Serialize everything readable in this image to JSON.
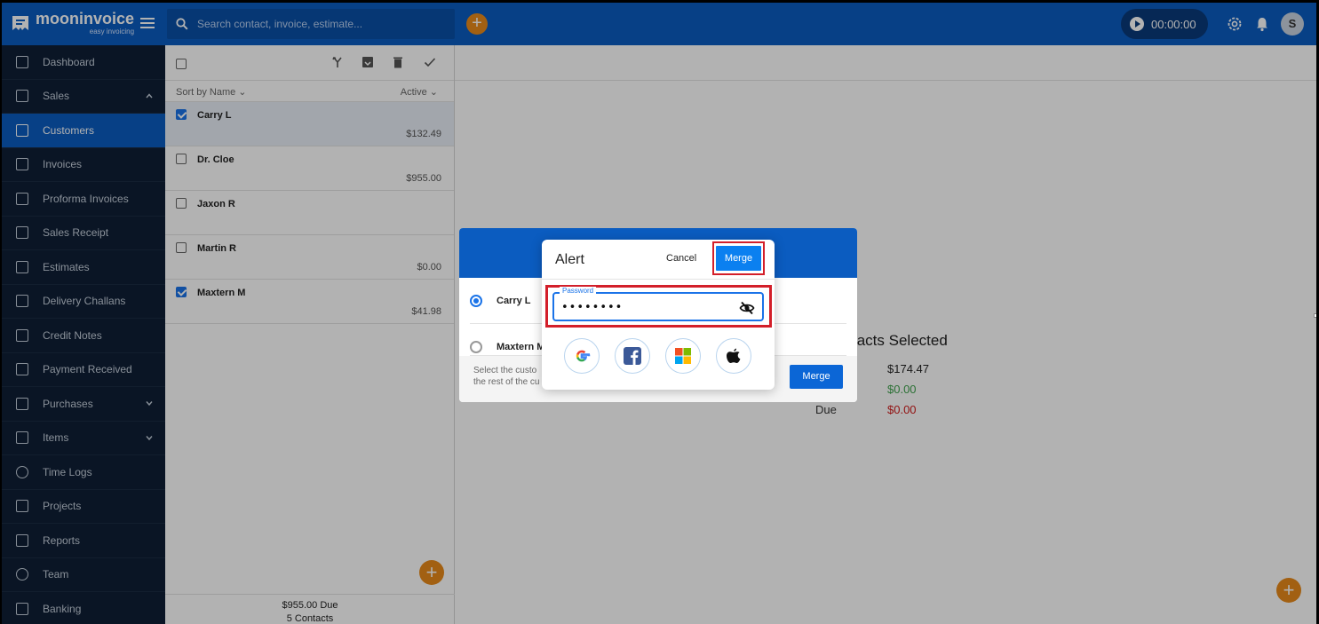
{
  "app": {
    "name": "mooninvoice",
    "tagline": "easy invoicing"
  },
  "search": {
    "placeholder": "Search contact, invoice, estimate..."
  },
  "timer": {
    "value": "00:00:00"
  },
  "user": {
    "initial": "S"
  },
  "sidebar": {
    "items": [
      {
        "label": "Dashboard",
        "icon": "home-icon"
      },
      {
        "label": "Sales",
        "icon": "dollar-icon",
        "expanded": true
      },
      {
        "label": "Customers",
        "icon": "contacts-icon",
        "active": true
      },
      {
        "label": "Invoices",
        "icon": "document-icon"
      },
      {
        "label": "Proforma Invoices",
        "icon": "document-icon"
      },
      {
        "label": "Sales Receipt",
        "icon": "receipt-icon"
      },
      {
        "label": "Estimates",
        "icon": "calculator-icon"
      },
      {
        "label": "Delivery Challans",
        "icon": "delivery-icon"
      },
      {
        "label": "Credit Notes",
        "icon": "note-icon"
      },
      {
        "label": "Payment Received",
        "icon": "payment-icon"
      },
      {
        "label": "Purchases",
        "icon": "bag-icon",
        "collapsible": true
      },
      {
        "label": "Items",
        "icon": "list-icon",
        "collapsible": true
      },
      {
        "label": "Time Logs",
        "icon": "clock-icon"
      },
      {
        "label": "Projects",
        "icon": "folder-icon"
      },
      {
        "label": "Reports",
        "icon": "chart-icon"
      },
      {
        "label": "Team",
        "icon": "team-icon"
      },
      {
        "label": "Banking",
        "icon": "bank-icon"
      }
    ]
  },
  "list": {
    "sort_label": "Sort by Name",
    "filter_label": "Active",
    "contacts": [
      {
        "name": "Carry L",
        "amount": "$132.49",
        "checked": true
      },
      {
        "name": "Dr. Cloe",
        "amount": "$955.00",
        "checked": false
      },
      {
        "name": "Jaxon R",
        "amount": "",
        "checked": false
      },
      {
        "name": "Martin R",
        "amount": "$0.00",
        "checked": false
      },
      {
        "name": "Maxtern M",
        "amount": "$41.98",
        "checked": true
      }
    ],
    "footer_due": "$955.00  Due",
    "footer_count": "5 Contacts"
  },
  "summary": {
    "title": "tacts Selected",
    "total": "$174.47",
    "paid": "$0.00",
    "due_label": "Due",
    "due": "$0.00"
  },
  "merge_modal": {
    "option_1": "Carry L",
    "option_2": "Maxtern M",
    "description_line1": "Select the custo",
    "description_line2": "the rest of the cu",
    "merge_label": "Merge"
  },
  "alert": {
    "title": "Alert",
    "cancel_label": "Cancel",
    "merge_label": "Merge",
    "password_label": "Password",
    "password_value": "••••••••"
  },
  "colors": {
    "brand": "#0b5cc0",
    "accent": "#e88a1a",
    "sidebar": "#0f1f35",
    "highlight": "#d31f2a",
    "positive": "#3fa34d",
    "negative": "#d11a1a"
  }
}
